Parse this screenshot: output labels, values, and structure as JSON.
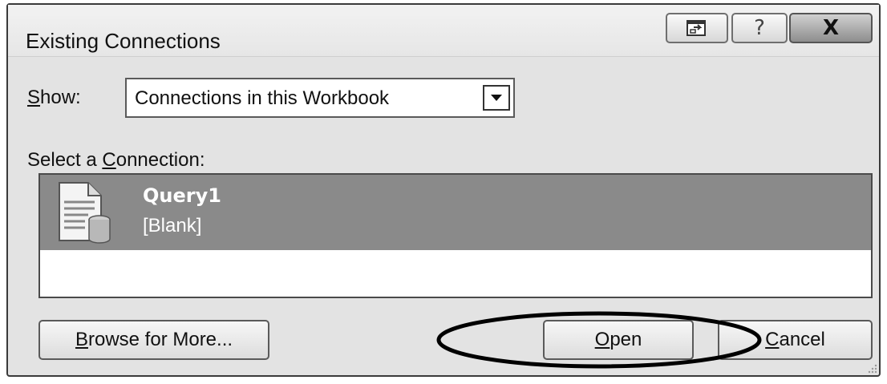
{
  "window": {
    "title": "Existing Connections",
    "title_buttons": {
      "restore_icon": "restore-window-icon",
      "help_label": "?",
      "close_label": "X"
    }
  },
  "show": {
    "label_accel": "S",
    "label_rest": "how:",
    "selected": "Connections in this Workbook",
    "dropdown_icon": "chevron-down-icon"
  },
  "connection_list": {
    "label_prefix": "Select a ",
    "label_accel": "C",
    "label_rest": "onnection:",
    "items": [
      {
        "icon": "data-document-icon",
        "name": "Query1",
        "description": "[Blank]",
        "selected": true
      }
    ]
  },
  "buttons": {
    "browse": {
      "accel": "B",
      "rest": "rowse for More..."
    },
    "open": {
      "accel": "O",
      "rest": "pen"
    },
    "cancel": {
      "accel": "C",
      "rest": "ancel"
    }
  },
  "colors": {
    "selection_bg": "#8a8a8a",
    "dialog_bg": "#e3e3e3",
    "annotation": "#000000"
  }
}
